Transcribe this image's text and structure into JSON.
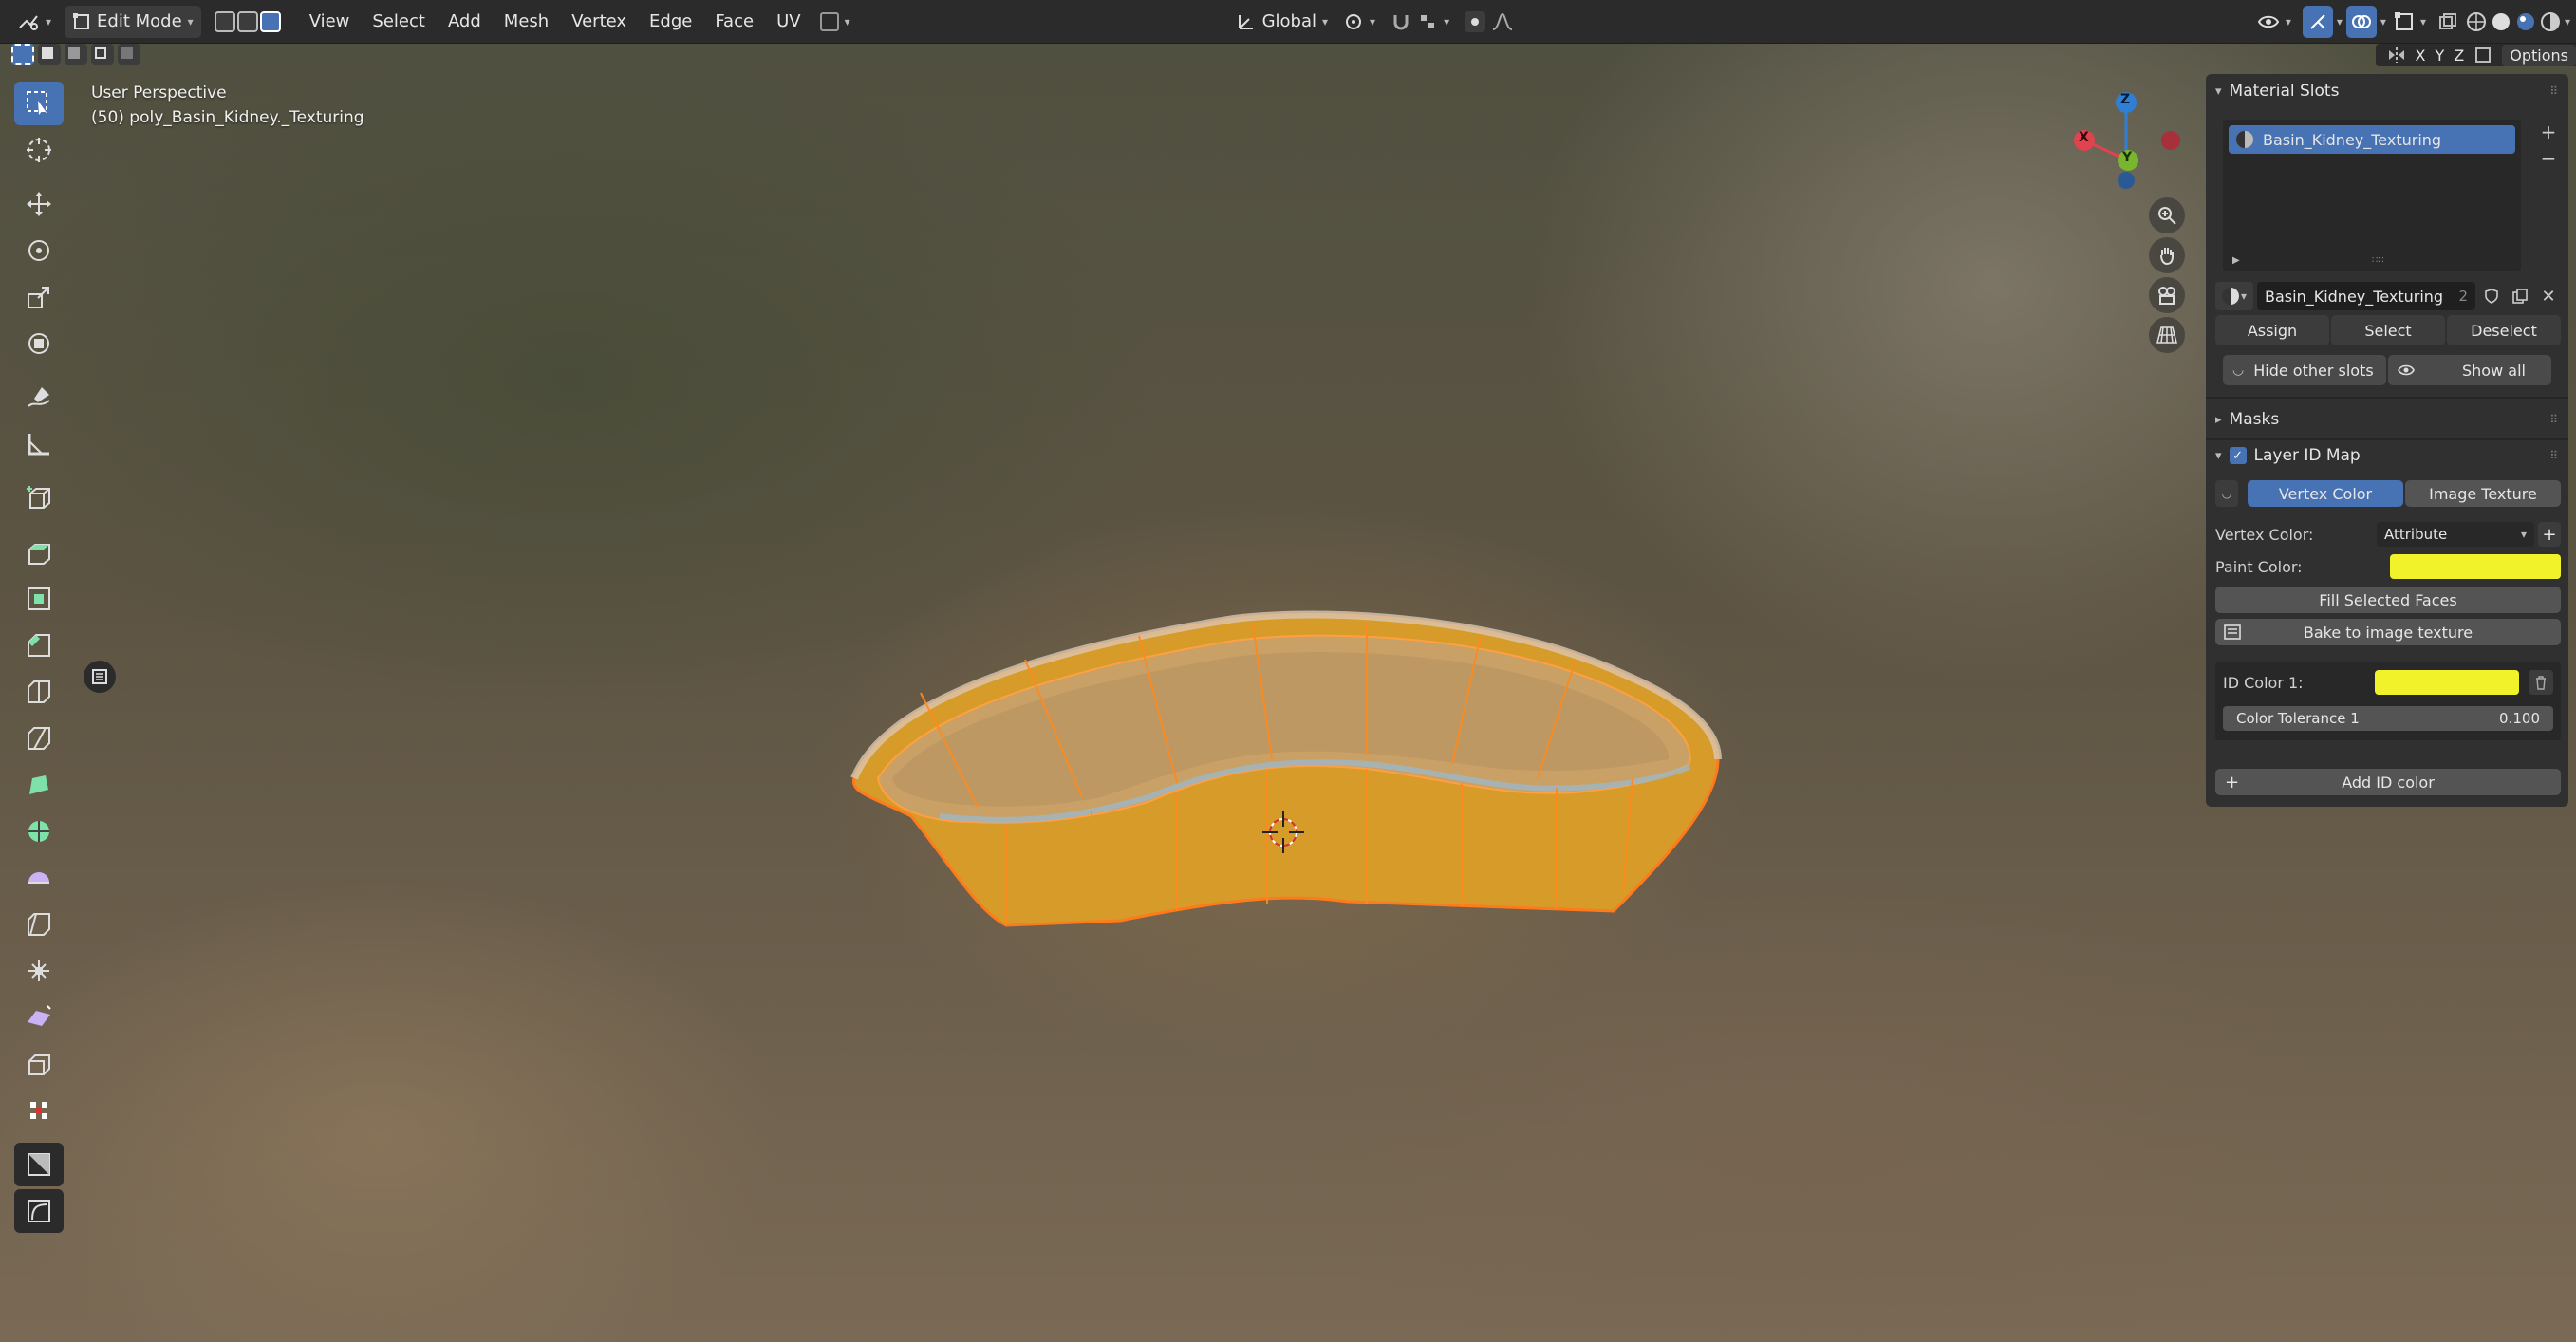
{
  "header": {
    "mode_label": "Edit Mode",
    "menus": [
      "View",
      "Select",
      "Add",
      "Mesh",
      "Vertex",
      "Edge",
      "Face",
      "UV"
    ],
    "orientation_label": "Global",
    "options_label": "Options"
  },
  "subheader": {
    "axes": [
      "X",
      "Y",
      "Z"
    ]
  },
  "viewport": {
    "view_name": "User Perspective",
    "object_info": "(50) poly_Basin_Kidney._Texturing"
  },
  "gizmo": {
    "x_label": "X",
    "y_label": "Y",
    "z_label": "Z",
    "colors": {
      "x": "#e0424f",
      "y": "#7ab52e",
      "z": "#2f7fd6"
    }
  },
  "panel": {
    "material_slots": {
      "title": "Material Slots",
      "slots": [
        "Basin_Kidney_Texturing"
      ],
      "material_name": "Basin_Kidney_Texturing",
      "user_count": "2",
      "assign_label": "Assign",
      "select_label": "Select",
      "deselect_label": "Deselect",
      "hide_other_label": "Hide other slots",
      "show_all_label": "Show all"
    },
    "masks": {
      "title": "Masks"
    },
    "layer_id_map": {
      "title": "Layer ID Map",
      "enabled": true,
      "tab_vertex": "Vertex Color",
      "tab_image": "Image Texture",
      "vertex_color_label": "Vertex Color:",
      "vertex_color_value": "Attribute",
      "paint_color_label": "Paint Color:",
      "paint_color": "#f2f22a",
      "fill_label": "Fill Selected Faces",
      "bake_label": "Bake to image texture",
      "id_color_label": "ID Color 1:",
      "id_color": "#f2f22a",
      "tolerance_label": "Color Tolerance 1",
      "tolerance_value": "0.100",
      "add_id_label": "Add ID color"
    },
    "accent": "#4772b3"
  }
}
